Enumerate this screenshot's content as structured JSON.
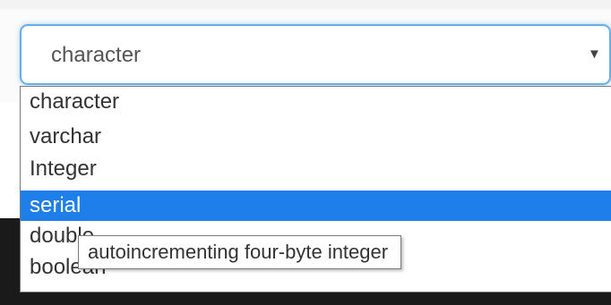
{
  "select": {
    "value": "character",
    "caret_icon": "▼"
  },
  "dropdown": {
    "options": [
      {
        "label": "character",
        "selected": false
      },
      {
        "label": "varchar",
        "selected": false
      },
      {
        "label": "Integer",
        "selected": false
      },
      {
        "label": "serial",
        "selected": true
      },
      {
        "label": "double",
        "selected": false
      },
      {
        "label": "boolean",
        "selected": false
      }
    ]
  },
  "tooltip": {
    "text": "autoincrementing four-byte integer"
  },
  "colors": {
    "focus_border": "#66aee6",
    "selected_bg": "#1e7fea",
    "selected_text": "#ffffff"
  }
}
